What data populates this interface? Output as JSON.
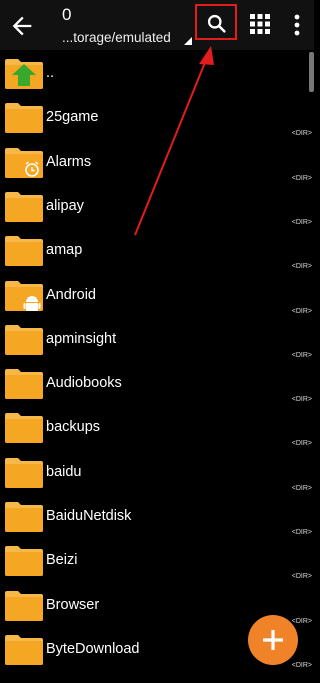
{
  "toolbar": {
    "count": "0",
    "path": "...torage/emulated",
    "back_icon": "arrow-left-icon",
    "search_icon": "search-icon",
    "grid_icon": "grid-view-icon",
    "more_icon": "more-vert-icon"
  },
  "colors": {
    "folder": "#f5a623",
    "folder_tab": "#f7b84a",
    "fab": "#f08327",
    "highlight": "#e31c1c",
    "toolbar_bg": "#111111",
    "page_bg": "#000000"
  },
  "files": [
    {
      "name": "..",
      "type": "up",
      "tag": ""
    },
    {
      "name": "25game",
      "type": "folder",
      "tag": "<DIR>"
    },
    {
      "name": "Alarms",
      "type": "alarm",
      "tag": "<DIR>"
    },
    {
      "name": "alipay",
      "type": "folder",
      "tag": "<DIR>"
    },
    {
      "name": "amap",
      "type": "folder",
      "tag": "<DIR>"
    },
    {
      "name": "Android",
      "type": "android",
      "tag": "<DIR>"
    },
    {
      "name": "apminsight",
      "type": "folder",
      "tag": "<DIR>"
    },
    {
      "name": "Audiobooks",
      "type": "folder",
      "tag": "<DIR>"
    },
    {
      "name": "backups",
      "type": "folder",
      "tag": "<DIR>"
    },
    {
      "name": "baidu",
      "type": "folder",
      "tag": "<DIR>"
    },
    {
      "name": "BaiduNetdisk",
      "type": "folder",
      "tag": "<DIR>"
    },
    {
      "name": "Beizi",
      "type": "folder",
      "tag": "<DIR>"
    },
    {
      "name": "Browser",
      "type": "folder",
      "tag": "<DIR>"
    },
    {
      "name": "ByteDownload",
      "type": "folder",
      "tag": "<DIR>"
    }
  ],
  "fab_icon": "plus-icon"
}
